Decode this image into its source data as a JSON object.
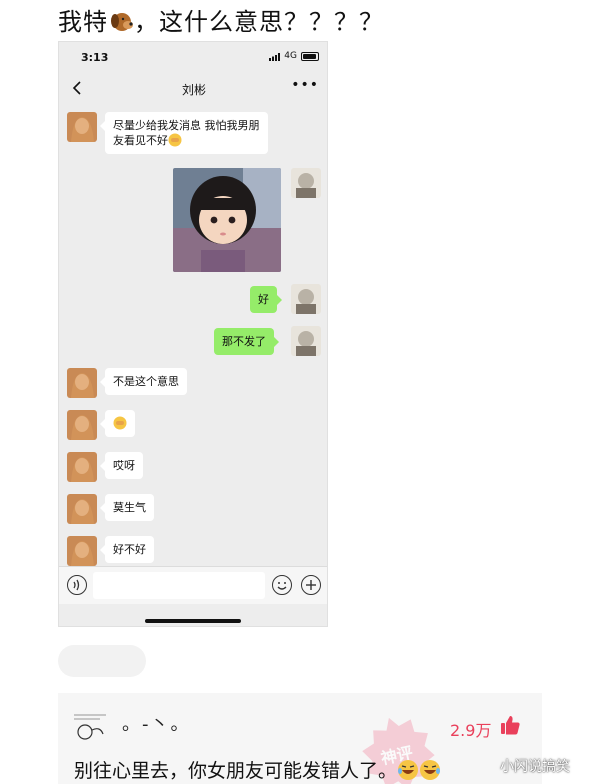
{
  "post": {
    "title_before": "我特",
    "title_after": "，这什么意思？？？？"
  },
  "phone": {
    "status": {
      "time": "3:13",
      "network": "4G"
    },
    "nav": {
      "title": "刘彬"
    },
    "messages": [
      {
        "side": "in",
        "line1": "尽量少给我发消息  我怕我男朋",
        "line2": "友看见不好"
      },
      {
        "side": "out",
        "text": "好"
      },
      {
        "side": "out",
        "text": "那不发了"
      },
      {
        "side": "in",
        "text": "不是这个意思"
      },
      {
        "side": "in",
        "text": ""
      },
      {
        "side": "in",
        "text": "哎呀"
      },
      {
        "side": "in",
        "text": "莫生气"
      },
      {
        "side": "in",
        "text": "好不好"
      }
    ],
    "input": {
      "value": ""
    }
  },
  "comment": {
    "username": "。-丶。",
    "likes": "2.9万",
    "stamp": "神评",
    "text": "别往心里去，你女朋友可能发错人了。"
  },
  "watermark": "小闪说搞笑",
  "colors": {
    "bubble_out": "#95ec69",
    "bubble_in": "#ffffff",
    "chat_bg": "#ededed",
    "like": "#e9405b"
  }
}
